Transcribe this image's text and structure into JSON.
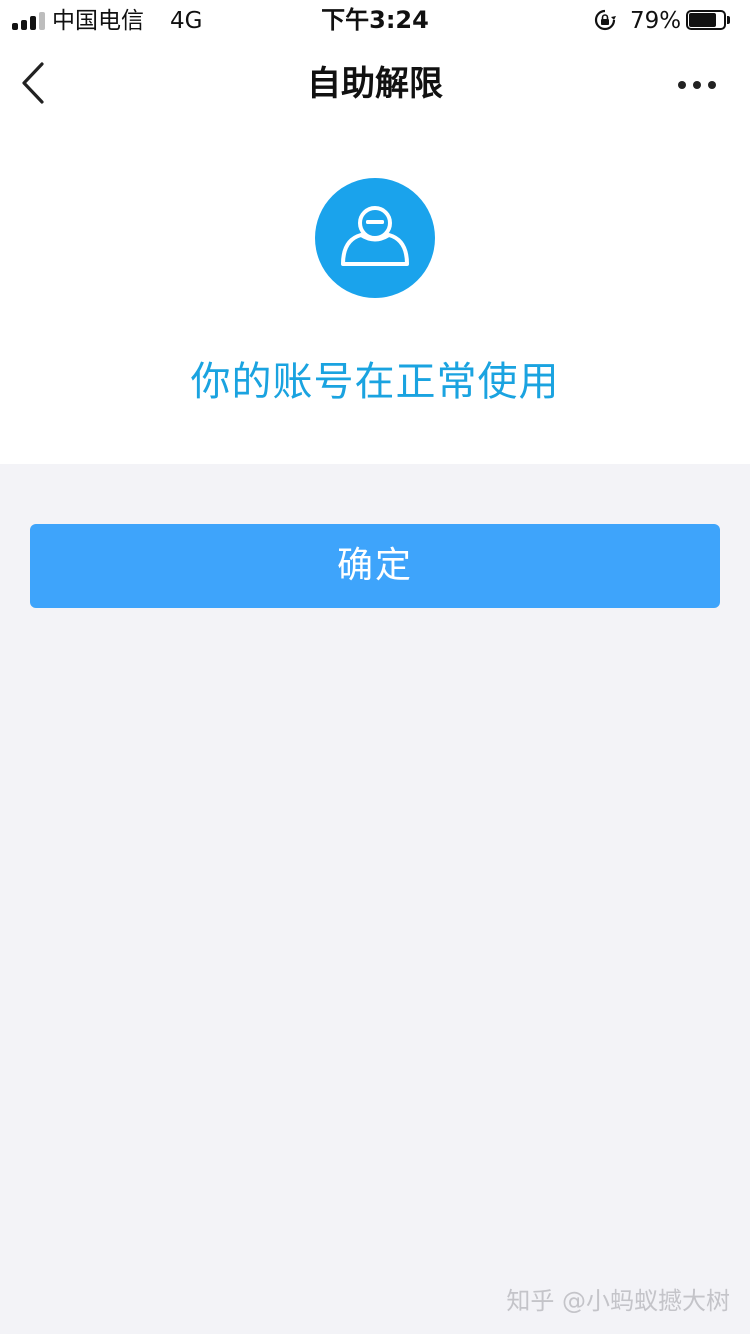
{
  "status_bar": {
    "carrier": "中国电信",
    "network": "4G",
    "time": "下午3:24",
    "battery_percent": "79%",
    "battery_level": 0.79,
    "icons": [
      "signal-icon",
      "rotation-lock-icon",
      "battery-icon"
    ]
  },
  "nav_bar": {
    "title": "自助解限",
    "icons": [
      "back-chevron-icon",
      "more-dots-icon"
    ]
  },
  "profile": {
    "avatar_icon": "user-avatar-icon",
    "message": "你的账号在正常使用"
  },
  "actions": {
    "confirm_label": "确定"
  },
  "watermark": {
    "text": "知乎 @小蚂蚁撼大树"
  },
  "colors": {
    "accent": "#1aa3ec",
    "button": "#3ea4fb",
    "message_text": "#1aa3e0",
    "page_background": "#f3f3f7"
  }
}
